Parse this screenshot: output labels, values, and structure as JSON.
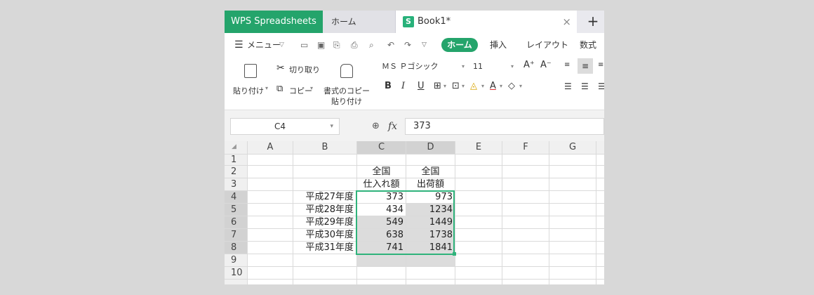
{
  "tabs": {
    "brand": "WPS Spreadsheets",
    "home": "ホーム",
    "book": "Book1*",
    "book_icon": "S",
    "close": "×",
    "add": "+"
  },
  "menu": {
    "menu_label": "メニュー",
    "home": "ホーム",
    "insert": "挿入",
    "layout": "レイアウト",
    "formulas": "数式"
  },
  "ribbon": {
    "cut": "切り取り",
    "paste": "貼り付け",
    "copy": "コピー",
    "format_paste_1": "書式のコピー",
    "format_paste_2": "貼り付け",
    "font": "ＭＳ Ｐゴシック",
    "size": "11",
    "bold": "B",
    "italic": "I",
    "underline": "U"
  },
  "formula_bar": {
    "cell_ref": "C4",
    "fx": "fx",
    "value": "373"
  },
  "columns": [
    "A",
    "B",
    "C",
    "D",
    "E",
    "F",
    "G"
  ],
  "rows": [
    "1",
    "2",
    "3",
    "4",
    "5",
    "6",
    "7",
    "8",
    "9",
    "10"
  ],
  "cells": {
    "C2": "全国",
    "D2": "全国",
    "C3": "仕入れ額",
    "D3": "出荷額",
    "B4": "平成27年度",
    "C4": "373",
    "D4": "973",
    "B5": "平成28年度",
    "C5": "434",
    "D5": "1234",
    "B6": "平成29年度",
    "C6": "549",
    "D6": "1449",
    "B7": "平成30年度",
    "C7": "638",
    "D7": "1738",
    "B8": "平成31年度",
    "C8": "741",
    "D8": "1841"
  },
  "colors": {
    "accent": "#24a46b",
    "selection_border": "#2fb37b"
  }
}
